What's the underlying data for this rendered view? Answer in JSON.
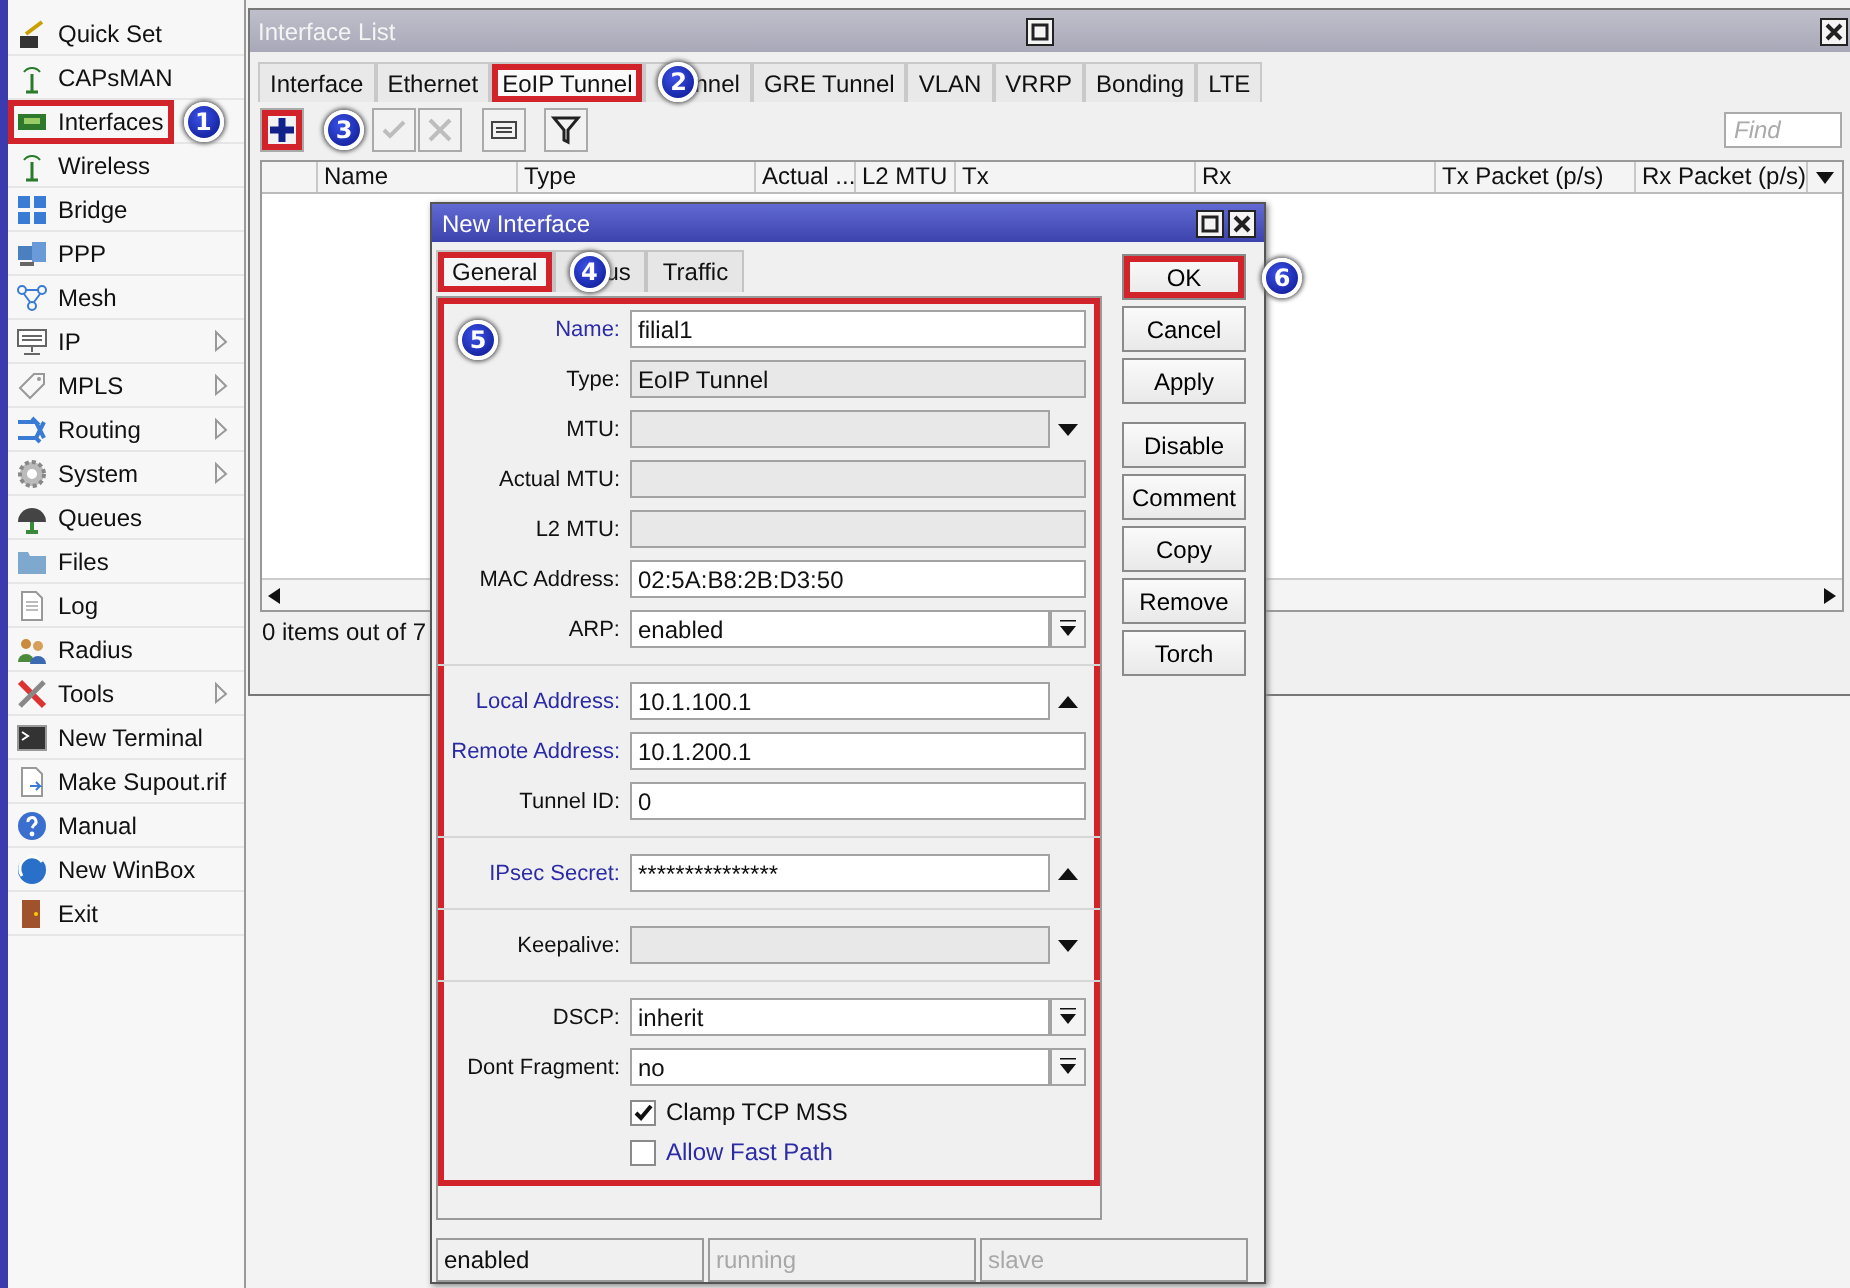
{
  "sidebar": {
    "items": [
      {
        "label": "Quick Set",
        "submenu": false,
        "highlighted": false
      },
      {
        "label": "CAPsMAN",
        "submenu": false,
        "highlighted": false
      },
      {
        "label": "Interfaces",
        "submenu": false,
        "highlighted": true,
        "badge": "1"
      },
      {
        "label": "Wireless",
        "submenu": false,
        "highlighted": false
      },
      {
        "label": "Bridge",
        "submenu": false,
        "highlighted": false
      },
      {
        "label": "PPP",
        "submenu": false,
        "highlighted": false
      },
      {
        "label": "Mesh",
        "submenu": false,
        "highlighted": false
      },
      {
        "label": "IP",
        "submenu": true,
        "highlighted": false
      },
      {
        "label": "MPLS",
        "submenu": true,
        "highlighted": false
      },
      {
        "label": "Routing",
        "submenu": true,
        "highlighted": false
      },
      {
        "label": "System",
        "submenu": true,
        "highlighted": false
      },
      {
        "label": "Queues",
        "submenu": false,
        "highlighted": false
      },
      {
        "label": "Files",
        "submenu": false,
        "highlighted": false
      },
      {
        "label": "Log",
        "submenu": false,
        "highlighted": false
      },
      {
        "label": "Radius",
        "submenu": false,
        "highlighted": false
      },
      {
        "label": "Tools",
        "submenu": true,
        "highlighted": false
      },
      {
        "label": "New Terminal",
        "submenu": false,
        "highlighted": false
      },
      {
        "label": "Make Supout.rif",
        "submenu": false,
        "highlighted": false
      },
      {
        "label": "Manual",
        "submenu": false,
        "highlighted": false
      },
      {
        "label": "New WinBox",
        "submenu": false,
        "highlighted": false
      },
      {
        "label": "Exit",
        "submenu": false,
        "highlighted": false
      }
    ]
  },
  "interface_list": {
    "title": "Interface List",
    "tabs": [
      {
        "label": "Interface",
        "selected": false,
        "highlighted": false
      },
      {
        "label": "Ethernet",
        "selected": false,
        "highlighted": false
      },
      {
        "label": "EoIP Tunnel",
        "selected": true,
        "highlighted": true,
        "badge": "2"
      },
      {
        "label": "nnel",
        "selected": false,
        "highlighted": false
      },
      {
        "label": "GRE Tunnel",
        "selected": false,
        "highlighted": false
      },
      {
        "label": "VLAN",
        "selected": false,
        "highlighted": false
      },
      {
        "label": "VRRP",
        "selected": false,
        "highlighted": false
      },
      {
        "label": "Bonding",
        "selected": false,
        "highlighted": false
      },
      {
        "label": "LTE",
        "selected": false,
        "highlighted": false
      }
    ],
    "toolbar": [
      {
        "kind": "add",
        "disabled": false,
        "highlighted": true,
        "badge": "3"
      },
      {
        "kind": "enable",
        "disabled": true,
        "highlighted": false
      },
      {
        "kind": "disable",
        "disabled": true,
        "highlighted": false
      },
      {
        "kind": "comment",
        "disabled": false,
        "highlighted": false
      },
      {
        "kind": "filter",
        "disabled": false,
        "highlighted": false
      }
    ],
    "find": {
      "placeholder": "Find"
    },
    "table": {
      "columns": [
        "Name",
        "Type",
        "Actual ...",
        "L2 MTU",
        "Tx",
        "Rx",
        "Tx Packet (p/s)",
        "Rx Packet (p/s)"
      ]
    },
    "status": "0 items out of 7"
  },
  "dialog": {
    "title": "New Interface",
    "tabs": [
      {
        "label": "General",
        "selected": true,
        "highlighted": true,
        "badge": "4"
      },
      {
        "label": "us",
        "selected": false,
        "highlighted": false
      },
      {
        "label": "Traffic",
        "selected": false,
        "highlighted": false
      }
    ],
    "form": {
      "highlighted": true,
      "badge": "5",
      "sections": [
        [
          {
            "kind": "text",
            "label": "Name:",
            "value": "filial1",
            "editable": true,
            "emphasized": true
          },
          {
            "kind": "text",
            "label": "Type:",
            "value": "EoIP Tunnel",
            "editable": false,
            "emphasized": false
          },
          {
            "kind": "dropdown",
            "label": "MTU:",
            "editable": false,
            "emphasized": false
          },
          {
            "kind": "text",
            "label": "Actual MTU:",
            "editable": false,
            "emphasized": false
          },
          {
            "kind": "text",
            "label": "L2 MTU:",
            "editable": false,
            "emphasized": false
          },
          {
            "kind": "text",
            "label": "MAC Address:",
            "value": "02:5A:B8:2B:D3:50",
            "editable": true,
            "emphasized": false
          },
          {
            "kind": "select",
            "label": "ARP:",
            "value": "enabled",
            "editable": true,
            "emphasized": false
          }
        ],
        [
          {
            "kind": "collapse",
            "label": "Local Address:",
            "value": "10.1.100.1",
            "editable": true,
            "emphasized": true
          },
          {
            "kind": "text",
            "label": "Remote Address:",
            "value": "10.1.200.1",
            "editable": true,
            "emphasized": true
          },
          {
            "kind": "text",
            "label": "Tunnel ID:",
            "value": "0",
            "editable": true,
            "emphasized": false
          }
        ],
        [
          {
            "kind": "collapse",
            "label": "IPsec Secret:",
            "value": "***************",
            "editable": true,
            "emphasized": true
          }
        ],
        [
          {
            "kind": "dropdown",
            "label": "Keepalive:",
            "editable": false,
            "emphasized": false
          }
        ],
        [
          {
            "kind": "select",
            "label": "DSCP:",
            "value": "inherit",
            "editable": true,
            "emphasized": false
          },
          {
            "kind": "select",
            "label": "Dont Fragment:",
            "value": "no",
            "editable": true,
            "emphasized": false
          },
          {
            "kind": "checkbox",
            "label": "Clamp TCP MSS",
            "checked": true,
            "emphasized": false
          },
          {
            "kind": "checkbox",
            "label": "Allow Fast Path",
            "checked": false,
            "emphasized": true
          }
        ]
      ]
    },
    "button_groups": [
      [
        {
          "label": "OK",
          "highlighted": true,
          "badge": "6"
        },
        {
          "label": "Cancel",
          "highlighted": false
        },
        {
          "label": "Apply",
          "highlighted": false
        }
      ],
      [
        {
          "label": "Disable",
          "highlighted": false
        },
        {
          "label": "Comment",
          "highlighted": false
        },
        {
          "label": "Copy",
          "highlighted": false
        },
        {
          "label": "Remove",
          "highlighted": false
        },
        {
          "label": "Torch",
          "highlighted": false
        }
      ]
    ],
    "status_bar": [
      {
        "text": "enabled",
        "active": true
      },
      {
        "text": "running",
        "active": false
      },
      {
        "text": "slave",
        "active": false
      }
    ]
  }
}
